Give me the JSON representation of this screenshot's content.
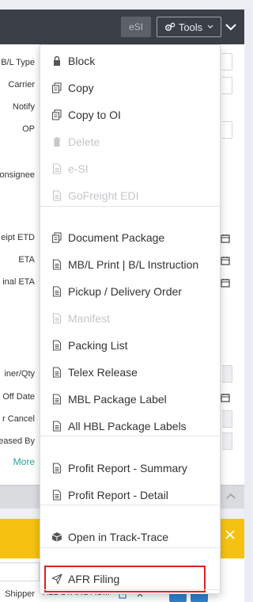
{
  "header": {
    "esi_button": "eSI",
    "tools_button": "Tools"
  },
  "form": {
    "labels": {
      "bl_type": "B/L Type",
      "carrier": "Carrier",
      "notify": "Notify",
      "op": "OP",
      "consignee": "onsignee",
      "receipt_etd": "eipt ETD",
      "eta": "ETA",
      "final_eta": "inal ETA",
      "container_qty": "iner/Qty",
      "off_date": "Off Date",
      "cancel": "r Cancel",
      "released_by": "eased By"
    },
    "more_link": "More",
    "shipper_label": "Shipper",
    "shipper_value": "ALL STARS AU..."
  },
  "menu": {
    "items": [
      {
        "label": "Block",
        "icon": "lock-icon",
        "disabled": false
      },
      {
        "label": "Copy",
        "icon": "copy-icon",
        "disabled": false
      },
      {
        "label": "Copy to OI",
        "icon": "copy-icon",
        "disabled": false
      },
      {
        "label": "Delete",
        "icon": "trash-icon",
        "disabled": true
      },
      {
        "label": "e-SI",
        "icon": "file-icon",
        "disabled": true
      },
      {
        "label": "GoFreight EDI",
        "icon": "file-icon",
        "disabled": true
      },
      {
        "label": "Document Package",
        "icon": "copy-icon",
        "disabled": false
      },
      {
        "label": "MB/L Print | B/L Instruction",
        "icon": "file-icon",
        "disabled": false
      },
      {
        "label": "Pickup / Delivery Order",
        "icon": "file-icon",
        "disabled": false
      },
      {
        "label": "Manifest",
        "icon": "file-icon",
        "disabled": true
      },
      {
        "label": "Packing List",
        "icon": "file-icon",
        "disabled": false
      },
      {
        "label": "Telex Release",
        "icon": "file-icon",
        "disabled": false
      },
      {
        "label": "MBL Package Label",
        "icon": "file-icon",
        "disabled": false
      },
      {
        "label": "All HBL Package Labels",
        "icon": "file-icon",
        "disabled": false
      },
      {
        "label": "Profit Report - Summary",
        "icon": "file-icon",
        "disabled": false
      },
      {
        "label": "Profit Report - Detail",
        "icon": "file-icon",
        "disabled": false
      },
      {
        "label": "Open in Track-Trace",
        "icon": "cube-icon",
        "disabled": false
      },
      {
        "label": "AFR Filing",
        "icon": "send-icon",
        "disabled": false
      }
    ]
  },
  "colors": {
    "header_bg": "#3a3f48",
    "accent_yellow": "#f5c211",
    "link_teal": "#26a69a",
    "highlight_red": "#e02020"
  }
}
